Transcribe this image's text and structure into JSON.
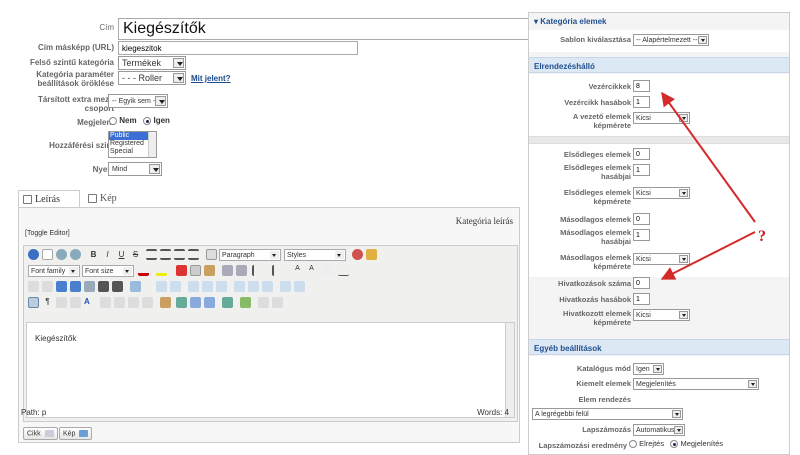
{
  "form": {
    "cim_label": "Cím",
    "cim_value": "Kiegészítők",
    "alias_label": "Cím másképp (URL)",
    "alias_value": "kiegeszitok",
    "parent_label": "Felső szintű kategória",
    "parent_value": "Termékek",
    "param_inherit_label": "Kategória paraméter beállítások öröklése",
    "param_inherit_value": "- - - Roller",
    "what_link": "Mit jelent?",
    "extra_group_label": "Társított extra mező csoport",
    "extra_group_value": "-- Egyik sem --",
    "published_label": "Megjelent",
    "published_no": "Nem",
    "published_yes": "Igen",
    "access_label": "Hozzáférési szint",
    "access_options": [
      "Public",
      "Registered",
      "Special"
    ],
    "language_label": "Nyelv",
    "language_value": "Mind"
  },
  "tabs": [
    {
      "label": "Leírás",
      "icon": "edit-icon"
    },
    {
      "label": "Kép",
      "icon": "image-icon"
    }
  ],
  "editor": {
    "title": "Kategória leírás",
    "toggle": "[Toggle Editor]",
    "format_select": "Paragraph",
    "styles_select": "Styles",
    "font_family": "Font family",
    "font_size": "Font size",
    "content": "Kiegészítők",
    "path": "Path: p",
    "words": "Words: 4",
    "btn_article": "Cikk",
    "btn_image": "Kép"
  },
  "right": {
    "section_title": "Kategória elemek",
    "template_label": "Sablon kiválasztása",
    "template_value": "-- Alapértelmezett --",
    "layout_header": "Elrendezéshálló",
    "lead_items_label": "Vezércikkek",
    "lead_items_value": "8",
    "lead_cols_label": "Vezércikk hasábok",
    "lead_cols_value": "1",
    "lead_img_label": "A vezető elemek képmérete",
    "lead_img_value": "Kicsi",
    "primary_items_label": "Elsődleges elemek",
    "primary_items_value": "0",
    "primary_cols_label": "Elsődleges elemek hasábjai",
    "primary_cols_value": "1",
    "primary_img_label": "Elsődleges elemek képmérete",
    "primary_img_value": "Kicsi",
    "secondary_items_label": "Másodlagos elemek",
    "secondary_items_value": "0",
    "secondary_cols_label": "Másodlagos elemek hasábjai",
    "secondary_cols_value": "1",
    "secondary_img_label": "Másodlagos elemek képmérete",
    "secondary_img_value": "Kicsi",
    "links_label": "Hivatkozások száma",
    "links_value": "0",
    "links_cols_label": "Hivatkozás hasábok",
    "links_cols_value": "1",
    "links_img_label": "Hivatkozott elemek képmérete",
    "links_img_value": "Kicsi",
    "other_header": "Egyéb beállítások",
    "catalog_label": "Katalógus mód",
    "catalog_value": "Igen",
    "featured_label": "Kiemelt elemek",
    "featured_value": "Megjelenítés",
    "ordering_label": "Elem rendezés",
    "ordering_value": "A legrégebbi felül",
    "pagination_label": "Lapszámozás",
    "pagination_value": "Automatikus",
    "pag_results_label": "Lapszámozási eredmény",
    "pag_results_hide": "Elrejtés",
    "pag_results_show": "Megjelenítés"
  },
  "annotation": {
    "question_mark": "?",
    "arrow_color": "#d42a2a"
  }
}
